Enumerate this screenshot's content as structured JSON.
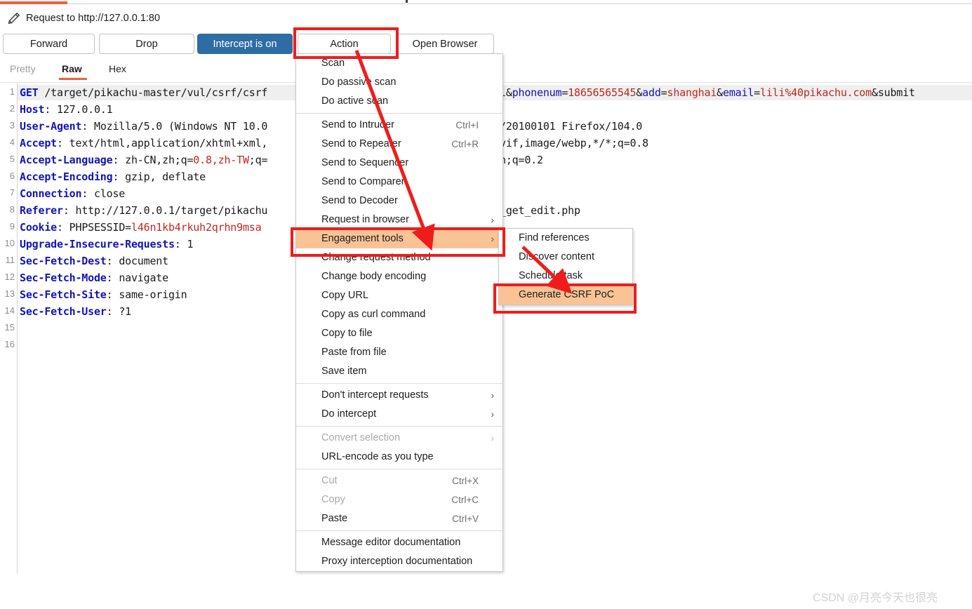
{
  "window": {
    "title": "Request to http://127.0.0.1:80",
    "edit_icon": "pencil-icon"
  },
  "toolbar": {
    "forward": "Forward",
    "drop": "Drop",
    "intercept": "Intercept is on",
    "action": "Action",
    "open_browser": "Open Browser",
    "intercept_color": "#2e6ca4"
  },
  "view_tabs": [
    {
      "label": "Pretty",
      "active": false
    },
    {
      "label": "Raw",
      "active": true
    },
    {
      "label": "Hex",
      "active": false
    }
  ],
  "editor": {
    "line_numbers": [
      "1",
      "2",
      "3",
      "4",
      "5",
      "6",
      "7",
      "8",
      "9",
      "10",
      "11",
      "12",
      "13",
      "14",
      "15",
      "16"
    ],
    "lines": [
      {
        "n": 1,
        "left": "GET /target/pikachu-master/vul/csrf/csrf",
        "right": "l&phonenum=18656565545&add=shanghai&email=lili%40pikachu.com&submit",
        "highlight": true
      },
      {
        "n": 2,
        "left": "Host: 127.0.0.1",
        "right": ""
      },
      {
        "n": 3,
        "left": "User-Agent: Mozilla/5.0 (Windows NT 10.0",
        "right": "/20100101 Firefox/104.0"
      },
      {
        "n": 4,
        "left": "Accept: text/html,application/xhtml+xml,",
        "right": "vif,image/webp,*/*;q=0.8"
      },
      {
        "n": 5,
        "left": "Accept-Language: zh-CN,zh;q=0.8,zh-TW;q=",
        "right": "n;q=0.2"
      },
      {
        "n": 6,
        "left": "Accept-Encoding: gzip, deflate",
        "right": ""
      },
      {
        "n": 7,
        "left": "Connection: close",
        "right": ""
      },
      {
        "n": 8,
        "left": "Referer: http://127.0.0.1/target/pikachu",
        "right": "_get_edit.php"
      },
      {
        "n": 9,
        "left": "Cookie: PHPSESSID=l46n1kb4rkuh2qrhn9msa",
        "right": ""
      },
      {
        "n": 10,
        "left": "Upgrade-Insecure-Requests: 1",
        "right": ""
      },
      {
        "n": 11,
        "left": "Sec-Fetch-Dest: document",
        "right": ""
      },
      {
        "n": 12,
        "left": "Sec-Fetch-Mode: navigate",
        "right": ""
      },
      {
        "n": 13,
        "left": "Sec-Fetch-Site: same-origin",
        "right": ""
      },
      {
        "n": 14,
        "left": "Sec-Fetch-User: ?1",
        "right": ""
      },
      {
        "n": 15,
        "left": "",
        "right": ""
      },
      {
        "n": 16,
        "left": "",
        "right": ""
      }
    ]
  },
  "context_menu": {
    "items": [
      {
        "label": "Scan"
      },
      {
        "label": "Do passive scan"
      },
      {
        "label": "Do active scan"
      },
      {
        "separator": true
      },
      {
        "label": "Send to Intruder",
        "shortcut": "Ctrl+I"
      },
      {
        "label": "Send to Repeater",
        "shortcut": "Ctrl+R"
      },
      {
        "label": "Send to Sequencer"
      },
      {
        "label": "Send to Comparer"
      },
      {
        "label": "Send to Decoder"
      },
      {
        "label": "Request in browser",
        "submenu": true
      },
      {
        "label": "Engagement tools",
        "submenu": true,
        "selected": true
      },
      {
        "label": "Change request method"
      },
      {
        "label": "Change body encoding"
      },
      {
        "label": "Copy URL"
      },
      {
        "label": "Copy as curl command"
      },
      {
        "label": "Copy to file"
      },
      {
        "label": "Paste from file"
      },
      {
        "label": "Save item"
      },
      {
        "separator": true
      },
      {
        "label": "Don't intercept requests",
        "submenu": true
      },
      {
        "label": "Do intercept",
        "submenu": true
      },
      {
        "separator": true
      },
      {
        "label": "Convert selection",
        "submenu": true,
        "disabled": true
      },
      {
        "label": "URL-encode as you type"
      },
      {
        "separator": true
      },
      {
        "label": "Cut",
        "shortcut": "Ctrl+X",
        "disabled": true
      },
      {
        "label": "Copy",
        "shortcut": "Ctrl+C",
        "disabled": true
      },
      {
        "label": "Paste",
        "shortcut": "Ctrl+V"
      },
      {
        "separator": true
      },
      {
        "label": "Message editor documentation"
      },
      {
        "label": "Proxy interception documentation"
      }
    ]
  },
  "submenu": {
    "items": [
      {
        "label": "Find references"
      },
      {
        "label": "Discover content"
      },
      {
        "label": "Schedule task"
      },
      {
        "label": "Generate CSRF PoC",
        "selected": true
      }
    ]
  },
  "annotations": {
    "highlight_color": "#f01c1c",
    "selected_color": "#f9c396",
    "boxes": [
      "action-button",
      "engagement-tools-item",
      "generate-csrf-poc-item"
    ]
  },
  "watermark": "CSDN @月亮今天也很亮"
}
